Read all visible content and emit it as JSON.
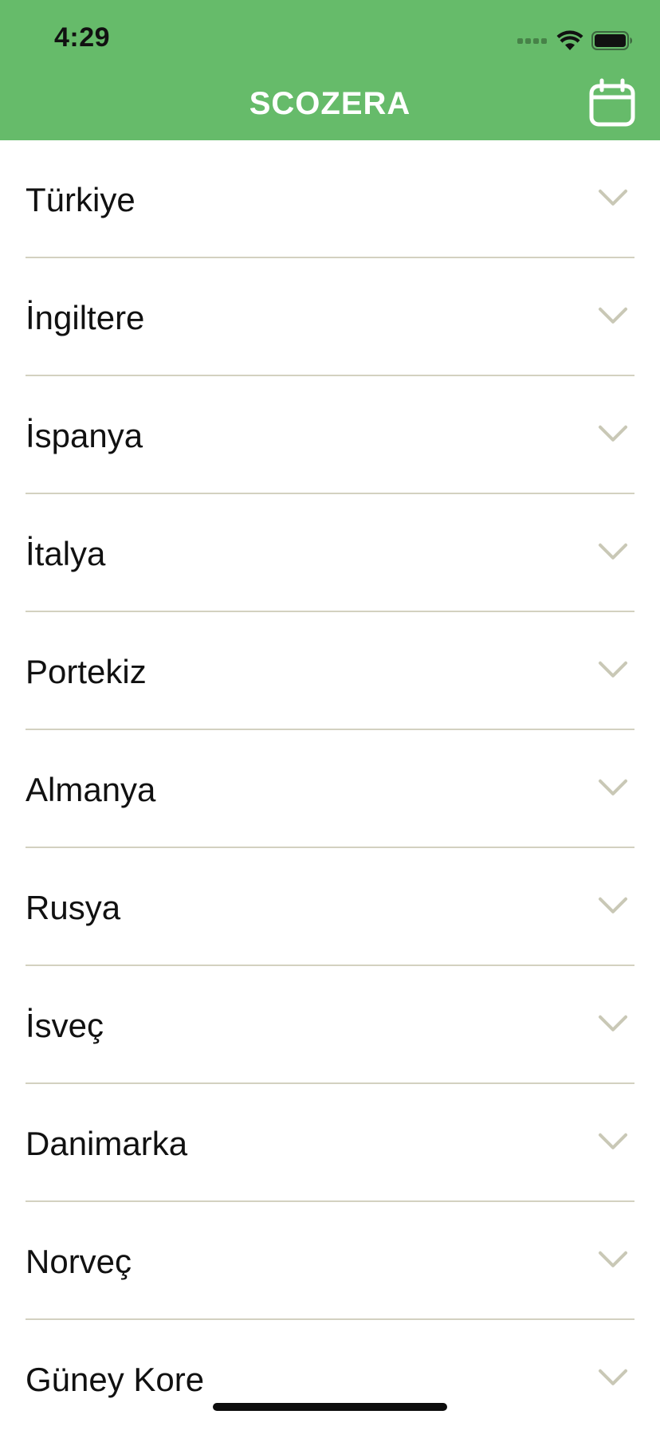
{
  "status_bar": {
    "time": "4:29"
  },
  "header": {
    "title": "SCOZERA",
    "background_color": "#66bb6a",
    "calendar_icon": "calendar-icon"
  },
  "countries": [
    {
      "label": "Türkiye"
    },
    {
      "label": "İngiltere"
    },
    {
      "label": "İspanya"
    },
    {
      "label": "İtalya"
    },
    {
      "label": "Portekiz"
    },
    {
      "label": "Almanya"
    },
    {
      "label": "Rusya"
    },
    {
      "label": "İsveç"
    },
    {
      "label": "Danimarka"
    },
    {
      "label": "Norveç"
    },
    {
      "label": "Güney Kore"
    }
  ],
  "colors": {
    "accent": "#66bb6a",
    "divider": "#d3d1c0",
    "chevron": "#c9c8b6"
  }
}
